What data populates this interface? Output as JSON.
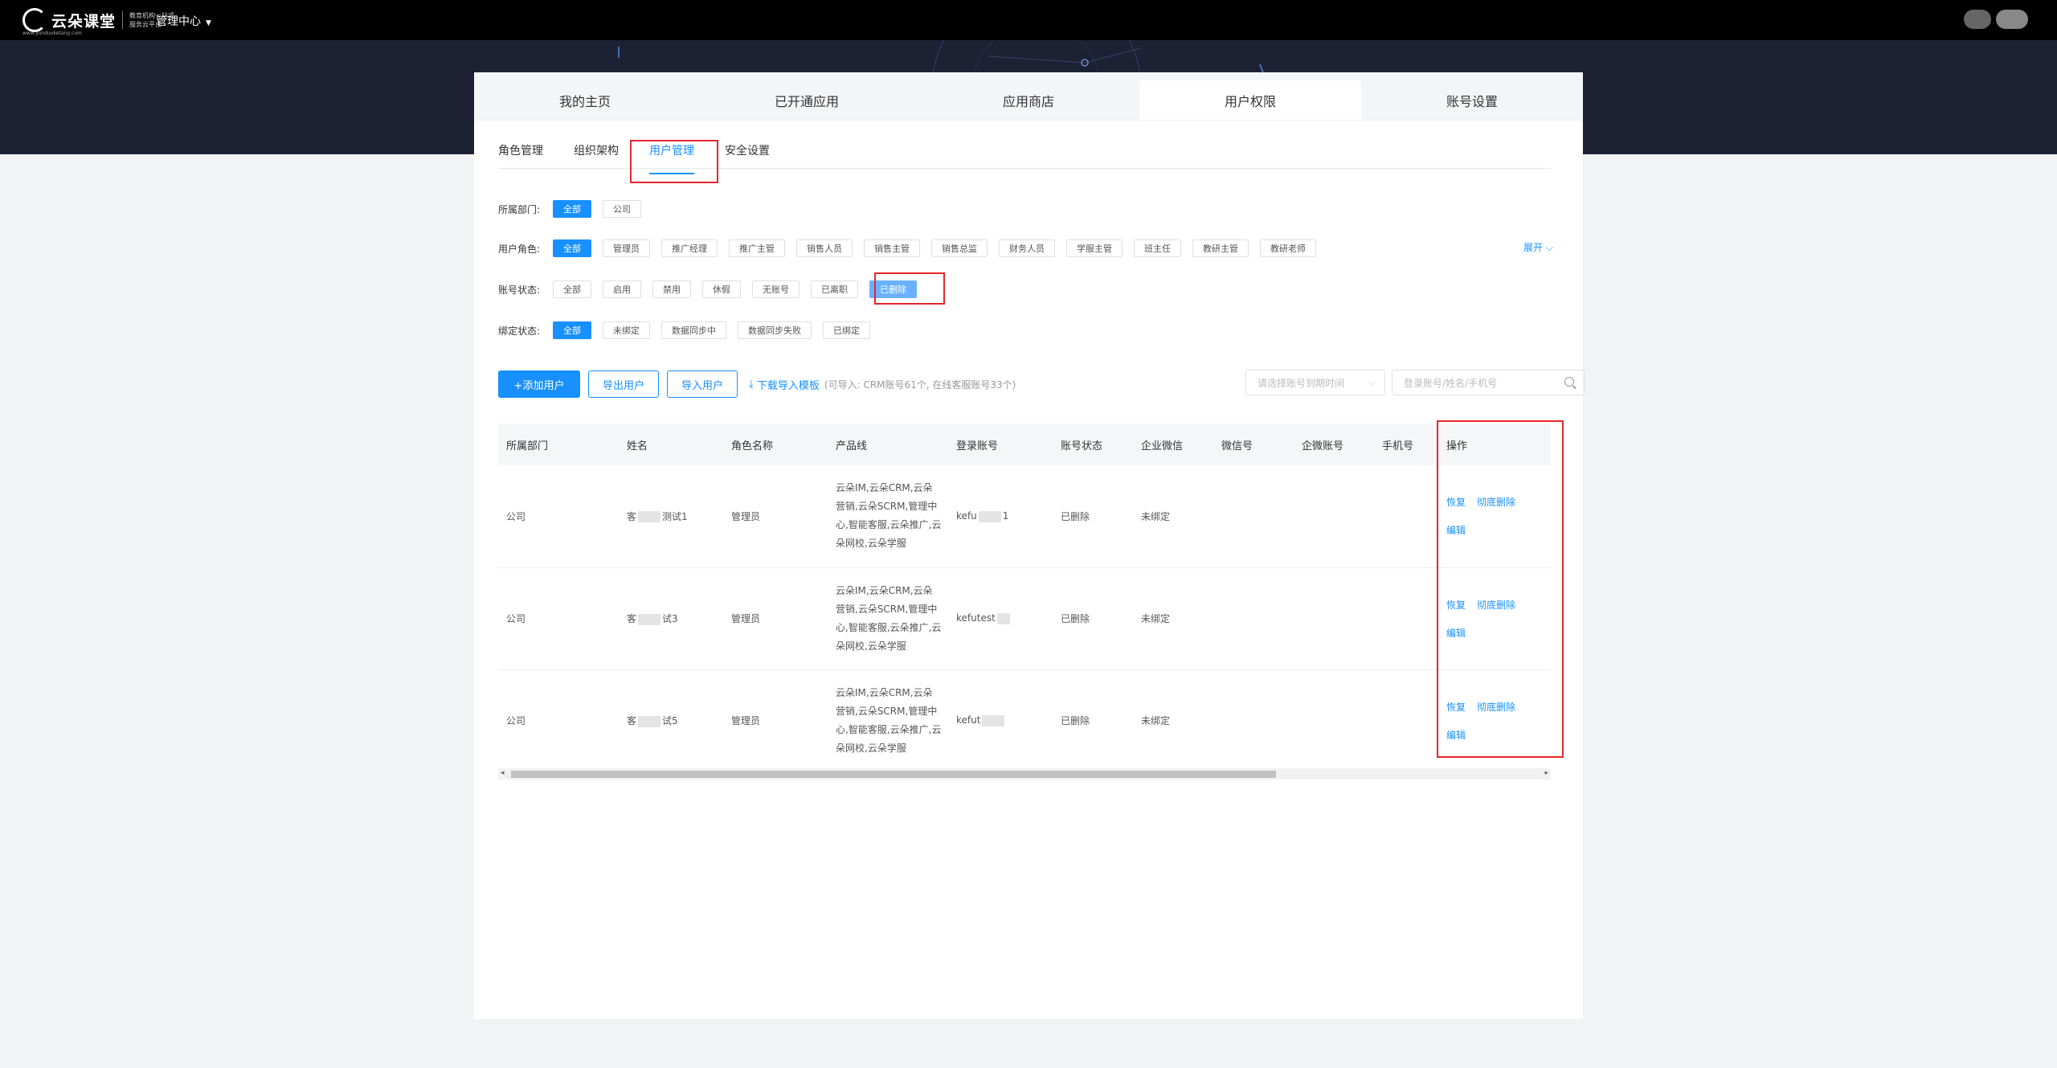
{
  "topbar": {
    "logo_text": "云朵课堂",
    "logo_slogan": "教育机构一站式服务云平台",
    "logo_url": "www.yunduoketang.com",
    "menu_label": "管理中心",
    "menu_caret": "▼"
  },
  "main_tabs": [
    {
      "label": "我的主页",
      "active": false
    },
    {
      "label": "已开通应用",
      "active": false
    },
    {
      "label": "应用商店",
      "active": false
    },
    {
      "label": "用户权限",
      "active": true
    },
    {
      "label": "账号设置",
      "active": false
    }
  ],
  "sub_tabs": [
    {
      "label": "角色管理",
      "active": false
    },
    {
      "label": "组织架构",
      "active": false
    },
    {
      "label": "用户管理",
      "active": true
    },
    {
      "label": "安全设置",
      "active": false
    }
  ],
  "filters": {
    "department": {
      "label": "所属部门:",
      "options": [
        "全部",
        "公司"
      ],
      "selected": "全部"
    },
    "role": {
      "label": "用户角色:",
      "options": [
        "全部",
        "管理员",
        "推广经理",
        "推广主管",
        "销售人员",
        "销售主管",
        "销售总监",
        "财务人员",
        "学服主管",
        "班主任",
        "教研主管",
        "教研老师"
      ],
      "selected": "全部"
    },
    "account_status": {
      "label": "账号状态:",
      "options": [
        "全部",
        "启用",
        "禁用",
        "休假",
        "无账号",
        "已离职",
        "已删除"
      ],
      "selected": "已删除"
    },
    "bind_status": {
      "label": "绑定状态:",
      "options": [
        "全部",
        "未绑定",
        "数据同步中",
        "数据同步失败",
        "已绑定"
      ],
      "selected": "全部"
    },
    "expand_label": "展开"
  },
  "toolbar": {
    "add_user": "+添加用户",
    "export_users": "导出用户",
    "import_users": "导入用户",
    "download_template": "下载导入模板",
    "import_hint": "(可导入: CRM账号61个, 在线客服账号33个)",
    "expire_select_placeholder": "请选择账号到期时间",
    "search_placeholder": "登录账号/姓名/手机号"
  },
  "table": {
    "columns": [
      "所属部门",
      "姓名",
      "角色名称",
      "产品线",
      "登录账号",
      "账号状态",
      "企业微信",
      "微信号",
      "企微账号",
      "手机号",
      "操作"
    ],
    "rows": [
      {
        "dept": "公司",
        "name_prefix": "客",
        "name_suffix": "测试1",
        "role": "管理员",
        "products": "云朵IM,云朵CRM,云朵营销,云朵SCRM,管理中心,智能客服,云朵推广,云朵网校,云朵学服",
        "login_prefix": "kefu",
        "login_suffix": "1",
        "status": "已删除",
        "wecom": "未绑定",
        "wechat": "",
        "wecom_account": "",
        "phone": ""
      },
      {
        "dept": "公司",
        "name_prefix": "客",
        "name_suffix": "试3",
        "role": "管理员",
        "products": "云朵IM,云朵CRM,云朵营销,云朵SCRM,管理中心,智能客服,云朵推广,云朵网校,云朵学服",
        "login_prefix": "kefutest",
        "login_suffix": "",
        "status": "已删除",
        "wecom": "未绑定",
        "wechat": "",
        "wecom_account": "",
        "phone": ""
      },
      {
        "dept": "公司",
        "name_prefix": "客",
        "name_suffix": "试5",
        "role": "管理员",
        "products": "云朵IM,云朵CRM,云朵营销,云朵SCRM,管理中心,智能客服,云朵推广,云朵网校,云朵学服",
        "login_prefix": "kefut",
        "login_suffix": "",
        "status": "已删除",
        "wecom": "未绑定",
        "wechat": "",
        "wecom_account": "",
        "phone": ""
      }
    ],
    "actions": {
      "restore": "恢复",
      "purge": "彻底删除",
      "edit": "编辑"
    }
  },
  "colors": {
    "accent": "#1890ff",
    "highlight_box": "#e5262c",
    "hero_bg": "#1c2234"
  }
}
